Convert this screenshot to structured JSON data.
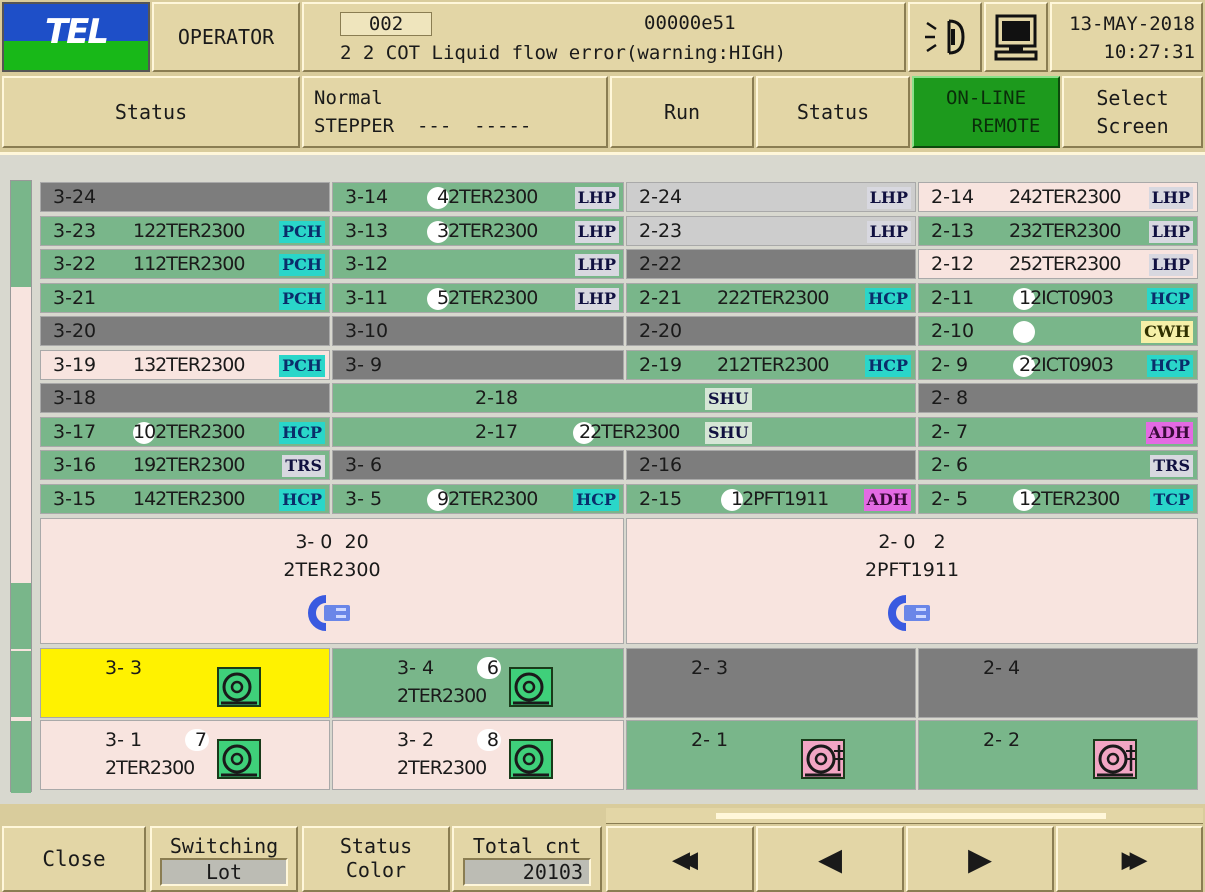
{
  "header": {
    "logo_text": "TEL",
    "operator_label": "OPERATOR",
    "alarm_no": "002",
    "alarm_code": "00000e51",
    "alarm_message": "2 2 COT Liquid flow error(warning:HIGH)",
    "date": "13-MAY-2018",
    "time": "10:27:31"
  },
  "toolbar": {
    "status_label": "Status",
    "mode_line1": "Normal",
    "mode_line2": "STEPPER  ---  -----",
    "run_label": "Run",
    "status2_label": "Status",
    "online_line1": "ON-LINE",
    "online_line2": "REMOTE",
    "select_line1": "Select",
    "select_line2": "Screen"
  },
  "colors": {
    "green_cell": "#79b68a",
    "dark_cell": "#7d7d7d",
    "pink_cell": "#f8e4df",
    "online_green": "#1d9a1d",
    "panel": "#e3d6a6"
  },
  "units": [
    {
      "id": "3-24",
      "lot": "",
      "tag": ""
    },
    {
      "id": "3-23",
      "lot": "122TER2300",
      "tag": "PCH"
    },
    {
      "id": "3-22",
      "lot": "112TER2300",
      "tag": "PCH"
    },
    {
      "id": "3-21",
      "lot": "",
      "tag": "PCH"
    },
    {
      "id": "3-20",
      "lot": "",
      "tag": ""
    },
    {
      "id": "3-19",
      "lot": "132TER2300",
      "tag": "PCH"
    },
    {
      "id": "3-18",
      "lot": "",
      "tag": ""
    },
    {
      "id": "3-17",
      "lot": "102TER2300",
      "tag": "HCP"
    },
    {
      "id": "3-16",
      "lot": "192TER2300",
      "tag": "TRS"
    },
    {
      "id": "3-15",
      "lot": "142TER2300",
      "tag": "HCP"
    },
    {
      "id": "3-14",
      "lot": "42TER2300",
      "tag": "LHP"
    },
    {
      "id": "3-13",
      "lot": "32TER2300",
      "tag": "LHP"
    },
    {
      "id": "3-12",
      "lot": "",
      "tag": "LHP"
    },
    {
      "id": "3-11",
      "lot": "52TER2300",
      "tag": "LHP"
    },
    {
      "id": "3-10",
      "lot": "",
      "tag": ""
    },
    {
      "id": "3- 9",
      "lot": "",
      "tag": ""
    },
    {
      "id": "2-18",
      "lot": "",
      "tag": "SHU"
    },
    {
      "id": "2-17",
      "lot": "22TER2300",
      "tag": "SHU"
    },
    {
      "id": "3- 6",
      "lot": "",
      "tag": ""
    },
    {
      "id": "3- 5",
      "lot": "92TER2300",
      "tag": "HCP"
    },
    {
      "id": "2-24",
      "lot": "",
      "tag": "LHP"
    },
    {
      "id": "2-23",
      "lot": "",
      "tag": "LHP"
    },
    {
      "id": "2-22",
      "lot": "",
      "tag": ""
    },
    {
      "id": "2-21",
      "lot": "222TER2300",
      "tag": "HCP"
    },
    {
      "id": "2-20",
      "lot": "",
      "tag": ""
    },
    {
      "id": "2-19",
      "lot": "212TER2300",
      "tag": "HCP"
    },
    {
      "id": "2-16",
      "lot": "",
      "tag": ""
    },
    {
      "id": "2-15",
      "lot": "12PFT1911",
      "tag": "ADH"
    },
    {
      "id": "2-14",
      "lot": "242TER2300",
      "tag": "LHP"
    },
    {
      "id": "2-13",
      "lot": "232TER2300",
      "tag": "LHP"
    },
    {
      "id": "2-12",
      "lot": "252TER2300",
      "tag": "LHP"
    },
    {
      "id": "2-11",
      "lot": "12ICT0903",
      "tag": "HCP"
    },
    {
      "id": "2-10",
      "lot": "",
      "tag": "CWH"
    },
    {
      "id": "2- 9",
      "lot": "22ICT0903",
      "tag": "HCP"
    },
    {
      "id": "2- 8",
      "lot": "",
      "tag": ""
    },
    {
      "id": "2- 7",
      "lot": "",
      "tag": "ADH"
    },
    {
      "id": "2- 6",
      "lot": "",
      "tag": "TRS"
    },
    {
      "id": "2- 5",
      "lot": "12TER2300",
      "tag": "TCP"
    }
  ],
  "robots": [
    {
      "line1": "3- 0  20",
      "line2": "2TER2300",
      "icon": "robot-arm-icon"
    },
    {
      "line1": "2- 0   2",
      "line2": "2PFT1911",
      "icon": "robot-arm-icon"
    }
  ],
  "coaters": [
    {
      "id": "3- 3",
      "cnt": "",
      "lot": ""
    },
    {
      "id": "3- 4",
      "cnt": "6",
      "lot": "2TER2300"
    },
    {
      "id": "2- 3",
      "cnt": "",
      "lot": ""
    },
    {
      "id": "2- 4",
      "cnt": "",
      "lot": ""
    },
    {
      "id": "3- 1",
      "cnt": "7",
      "lot": "2TER2300"
    },
    {
      "id": "3- 2",
      "cnt": "8",
      "lot": "2TER2300"
    },
    {
      "id": "2- 1",
      "cnt": "",
      "lot": ""
    },
    {
      "id": "2- 2",
      "cnt": "",
      "lot": ""
    }
  ],
  "footer": {
    "close_label": "Close",
    "switch_line1": "Switching",
    "switch_value": "Lot",
    "scolor_line1": "Status",
    "scolor_line2": "Color",
    "total_line1": "Total cnt",
    "total_value": "20103",
    "nav_first": "◀◀",
    "nav_prev": "◀",
    "nav_next": "▶",
    "nav_last": "▶▶"
  }
}
